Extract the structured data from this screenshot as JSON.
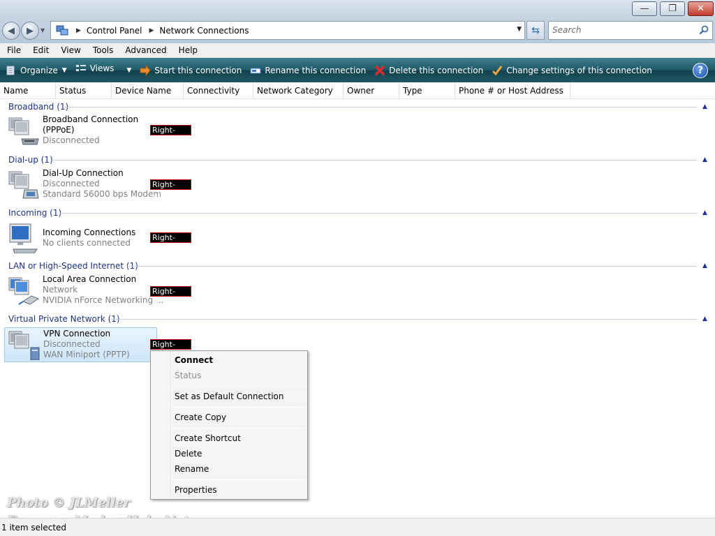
{
  "window": {
    "minimize_glyph": "—",
    "maximize_glyph": "❐",
    "close_glyph": "✕"
  },
  "address": {
    "breadcrumbs": [
      "Control Panel",
      "Network Connections"
    ],
    "search_placeholder": "Search"
  },
  "menu": [
    "File",
    "Edit",
    "View",
    "Tools",
    "Advanced",
    "Help"
  ],
  "commands": {
    "organize": "Organize",
    "views": "Views",
    "start": "Start this connection",
    "rename": "Rename this connection",
    "delete": "Delete this connection",
    "change": "Change settings of this connection",
    "help": "?"
  },
  "columns": [
    "Name",
    "Status",
    "Device Name",
    "Connectivity",
    "Network Category",
    "Owner",
    "Type",
    "Phone # or Host Address"
  ],
  "groups": [
    {
      "title": "Broadband (1)",
      "item": {
        "name": "Broadband Connection",
        "line2": "(PPPoE)",
        "line3": "Disconnected",
        "icon": "broadband-modem-icon"
      }
    },
    {
      "title": "Dial-up (1)",
      "item": {
        "name": "Dial-Up Connection",
        "line2": "Disconnected",
        "line3": "Standard 56000 bps Modem",
        "icon": "dialup-phone-icon"
      }
    },
    {
      "title": "Incoming (1)",
      "item": {
        "name": "Incoming Connections",
        "line2": "No clients connected",
        "line3": "",
        "icon": "incoming-monitor-icon"
      }
    },
    {
      "title": "LAN or High-Speed Internet (1)",
      "item": {
        "name": "Local Area Connection",
        "line2": "Network",
        "line3": "NVIDIA nForce Networking ...",
        "icon": "lan-network-icon"
      }
    },
    {
      "title": "Virtual Private Network (1)",
      "item": {
        "name": "VPN Connection",
        "line2": "Disconnected",
        "line3": "WAN Miniport (PPTP)",
        "icon": "vpn-tower-icon"
      }
    }
  ],
  "annotation": "Right-Click",
  "context_menu": {
    "connect": "Connect",
    "status": "Status",
    "set_default": "Set as Default Connection",
    "create_copy": "Create Copy",
    "create_shortcut": "Create Shortcut",
    "delete": "Delete",
    "rename": "Rename",
    "properties": "Properties"
  },
  "watermark": {
    "line1": "Photo © JLMeller",
    "line2": "Focus on ModemHelp.Net"
  },
  "status": "1 item selected",
  "colors": {
    "group_header": "#1e3287",
    "command_bar": "#1f5867",
    "selection": "#cde6fa"
  }
}
